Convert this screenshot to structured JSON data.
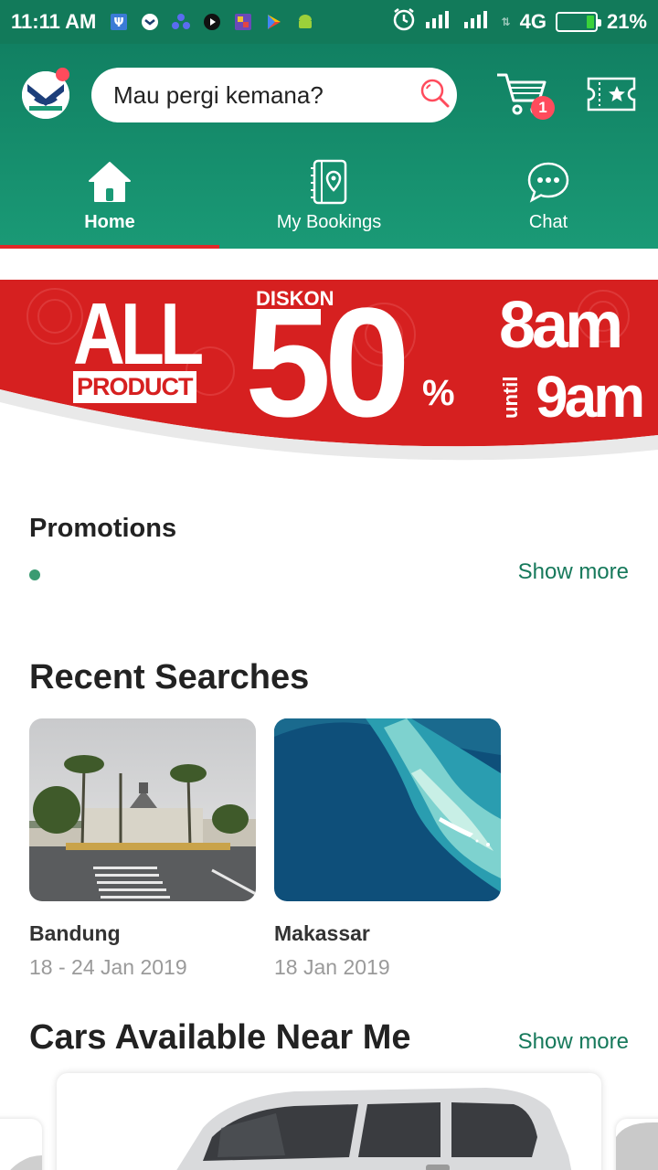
{
  "status_bar": {
    "time": "11:11 AM",
    "network": "4G",
    "battery": "21%",
    "battery_level": 0.21,
    "notification_icons": [
      "app-shield-icon",
      "app-badge-icon",
      "app-people-icon",
      "app-clapper-icon",
      "app-game-icon",
      "play-store-icon",
      "android-icon"
    ]
  },
  "header": {
    "search_placeholder": "Mau pergi kemana?",
    "cart_count": "1"
  },
  "nav": {
    "tabs": [
      {
        "label": "Home",
        "icon": "home-icon",
        "active": true
      },
      {
        "label": "My Bookings",
        "icon": "bookings-icon",
        "active": false
      },
      {
        "label": "Chat",
        "icon": "chat-icon",
        "active": false
      }
    ]
  },
  "banner": {
    "all": "ALL",
    "product": "PRODUCT",
    "diskon": "DISKON",
    "percent_value": "50",
    "percent_sign": "%",
    "time_start": "8am",
    "until": "until",
    "time_end": "9am",
    "colors": {
      "background": "#d62020",
      "text": "#ffffff"
    }
  },
  "promotions": {
    "title": "Promotions",
    "show_more": "Show more"
  },
  "recent_searches": {
    "title": "Recent Searches",
    "items": [
      {
        "city": "Bandung",
        "dates": "18 - 24 Jan 2019"
      },
      {
        "city": "Makassar",
        "dates": "18 Jan 2019"
      }
    ]
  },
  "cars": {
    "title": "Cars Available Near Me",
    "show_more": "Show more"
  },
  "colors": {
    "brand": "#16795b",
    "accent": "#e22828",
    "badge": "#ff4b5c"
  }
}
